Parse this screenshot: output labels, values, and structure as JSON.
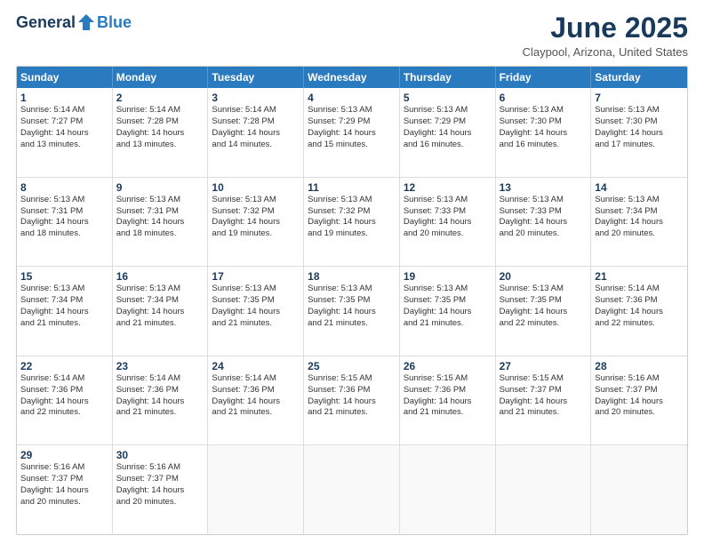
{
  "logo": {
    "general": "General",
    "blue": "Blue"
  },
  "title": "June 2025",
  "subtitle": "Claypool, Arizona, United States",
  "header_days": [
    "Sunday",
    "Monday",
    "Tuesday",
    "Wednesday",
    "Thursday",
    "Friday",
    "Saturday"
  ],
  "weeks": [
    [
      {
        "day": "1",
        "info": "Sunrise: 5:14 AM\nSunset: 7:27 PM\nDaylight: 14 hours\nand 13 minutes."
      },
      {
        "day": "2",
        "info": "Sunrise: 5:14 AM\nSunset: 7:28 PM\nDaylight: 14 hours\nand 13 minutes."
      },
      {
        "day": "3",
        "info": "Sunrise: 5:14 AM\nSunset: 7:28 PM\nDaylight: 14 hours\nand 14 minutes."
      },
      {
        "day": "4",
        "info": "Sunrise: 5:13 AM\nSunset: 7:29 PM\nDaylight: 14 hours\nand 15 minutes."
      },
      {
        "day": "5",
        "info": "Sunrise: 5:13 AM\nSunset: 7:29 PM\nDaylight: 14 hours\nand 16 minutes."
      },
      {
        "day": "6",
        "info": "Sunrise: 5:13 AM\nSunset: 7:30 PM\nDaylight: 14 hours\nand 16 minutes."
      },
      {
        "day": "7",
        "info": "Sunrise: 5:13 AM\nSunset: 7:30 PM\nDaylight: 14 hours\nand 17 minutes."
      }
    ],
    [
      {
        "day": "8",
        "info": "Sunrise: 5:13 AM\nSunset: 7:31 PM\nDaylight: 14 hours\nand 18 minutes."
      },
      {
        "day": "9",
        "info": "Sunrise: 5:13 AM\nSunset: 7:31 PM\nDaylight: 14 hours\nand 18 minutes."
      },
      {
        "day": "10",
        "info": "Sunrise: 5:13 AM\nSunset: 7:32 PM\nDaylight: 14 hours\nand 19 minutes."
      },
      {
        "day": "11",
        "info": "Sunrise: 5:13 AM\nSunset: 7:32 PM\nDaylight: 14 hours\nand 19 minutes."
      },
      {
        "day": "12",
        "info": "Sunrise: 5:13 AM\nSunset: 7:33 PM\nDaylight: 14 hours\nand 20 minutes."
      },
      {
        "day": "13",
        "info": "Sunrise: 5:13 AM\nSunset: 7:33 PM\nDaylight: 14 hours\nand 20 minutes."
      },
      {
        "day": "14",
        "info": "Sunrise: 5:13 AM\nSunset: 7:34 PM\nDaylight: 14 hours\nand 20 minutes."
      }
    ],
    [
      {
        "day": "15",
        "info": "Sunrise: 5:13 AM\nSunset: 7:34 PM\nDaylight: 14 hours\nand 21 minutes."
      },
      {
        "day": "16",
        "info": "Sunrise: 5:13 AM\nSunset: 7:34 PM\nDaylight: 14 hours\nand 21 minutes."
      },
      {
        "day": "17",
        "info": "Sunrise: 5:13 AM\nSunset: 7:35 PM\nDaylight: 14 hours\nand 21 minutes."
      },
      {
        "day": "18",
        "info": "Sunrise: 5:13 AM\nSunset: 7:35 PM\nDaylight: 14 hours\nand 21 minutes."
      },
      {
        "day": "19",
        "info": "Sunrise: 5:13 AM\nSunset: 7:35 PM\nDaylight: 14 hours\nand 21 minutes."
      },
      {
        "day": "20",
        "info": "Sunrise: 5:13 AM\nSunset: 7:35 PM\nDaylight: 14 hours\nand 22 minutes."
      },
      {
        "day": "21",
        "info": "Sunrise: 5:14 AM\nSunset: 7:36 PM\nDaylight: 14 hours\nand 22 minutes."
      }
    ],
    [
      {
        "day": "22",
        "info": "Sunrise: 5:14 AM\nSunset: 7:36 PM\nDaylight: 14 hours\nand 22 minutes."
      },
      {
        "day": "23",
        "info": "Sunrise: 5:14 AM\nSunset: 7:36 PM\nDaylight: 14 hours\nand 21 minutes."
      },
      {
        "day": "24",
        "info": "Sunrise: 5:14 AM\nSunset: 7:36 PM\nDaylight: 14 hours\nand 21 minutes."
      },
      {
        "day": "25",
        "info": "Sunrise: 5:15 AM\nSunset: 7:36 PM\nDaylight: 14 hours\nand 21 minutes."
      },
      {
        "day": "26",
        "info": "Sunrise: 5:15 AM\nSunset: 7:36 PM\nDaylight: 14 hours\nand 21 minutes."
      },
      {
        "day": "27",
        "info": "Sunrise: 5:15 AM\nSunset: 7:37 PM\nDaylight: 14 hours\nand 21 minutes."
      },
      {
        "day": "28",
        "info": "Sunrise: 5:16 AM\nSunset: 7:37 PM\nDaylight: 14 hours\nand 20 minutes."
      }
    ],
    [
      {
        "day": "29",
        "info": "Sunrise: 5:16 AM\nSunset: 7:37 PM\nDaylight: 14 hours\nand 20 minutes."
      },
      {
        "day": "30",
        "info": "Sunrise: 5:16 AM\nSunset: 7:37 PM\nDaylight: 14 hours\nand 20 minutes."
      },
      {
        "day": "",
        "info": ""
      },
      {
        "day": "",
        "info": ""
      },
      {
        "day": "",
        "info": ""
      },
      {
        "day": "",
        "info": ""
      },
      {
        "day": "",
        "info": ""
      }
    ]
  ]
}
